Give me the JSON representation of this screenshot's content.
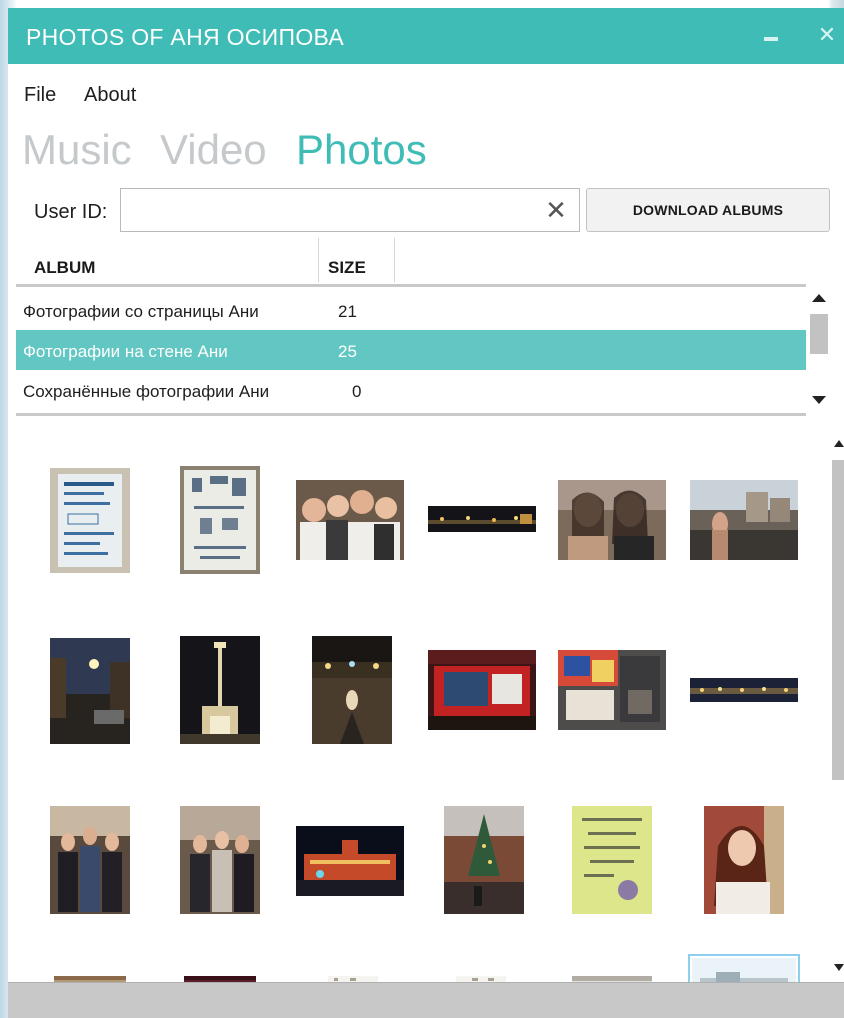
{
  "window": {
    "title": "PHOTOS OF АНЯ ОСИПОВА",
    "minimize_icon": "minimize-icon",
    "close_icon": "close-icon",
    "close_glyph": "✕",
    "accent_color": "#3fbcb6"
  },
  "menu": {
    "items": [
      {
        "label": "File"
      },
      {
        "label": "About"
      }
    ]
  },
  "tabs": [
    {
      "label": "Music",
      "active": false
    },
    {
      "label": "Video",
      "active": false
    },
    {
      "label": "Photos",
      "active": true
    }
  ],
  "user_id": {
    "label": "User ID:",
    "value": "",
    "placeholder": "",
    "clear_icon": "clear-icon",
    "clear_glyph": "✕"
  },
  "download_button": {
    "label": "DOWNLOAD ALBUMS"
  },
  "album_table": {
    "columns": [
      "ALBUM",
      "SIZE"
    ],
    "rows": [
      {
        "name": "Фотографии со страницы Ани",
        "size": "21",
        "selected": false
      },
      {
        "name": "Фотографии на стене Ани",
        "size": "25",
        "selected": true
      },
      {
        "name": "Сохранённые фотографии Ани",
        "size": "0",
        "selected": false
      }
    ],
    "selected_color": "#62c7c2"
  },
  "photo_grid": {
    "description_icons": "photo-thumbnail",
    "rows": 4,
    "columns": 6
  }
}
